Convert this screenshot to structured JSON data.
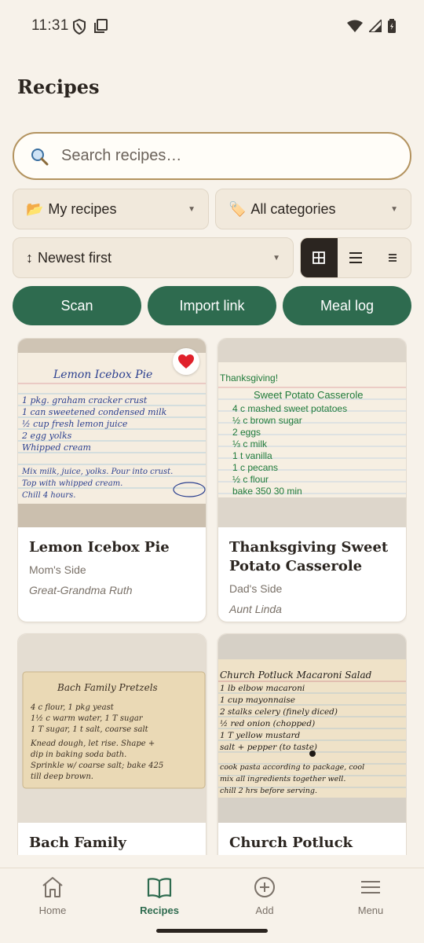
{
  "status": {
    "time": "11:31"
  },
  "title": "Recipes",
  "search": {
    "placeholder": "Search recipes…",
    "value": ""
  },
  "filters": {
    "source": {
      "emoji": "📂",
      "label": "My recipes"
    },
    "category": {
      "emoji": "🏷️",
      "label": "All categories"
    },
    "sort": {
      "emoji": "↕",
      "label": "Newest first"
    }
  },
  "view_modes": [
    "grid-view",
    "list-view",
    "compact-view"
  ],
  "active_view": "grid-view",
  "actions": {
    "scan": "Scan",
    "import": "Import link",
    "meal_log": "Meal log"
  },
  "recipes": [
    {
      "name": "Lemon Icebox Pie",
      "side": "Mom's Side",
      "author": "Great-Grandma Ruth",
      "favorite": true,
      "card_text": [
        "Lemon Icebox Pie",
        "1 pkg. graham cracker crust",
        "1 can sweetened condensed milk",
        "½ cup fresh lemon juice",
        "2 egg yolks",
        "Whipped cream",
        "Mix milk, juice, yolks. Pour into crust.",
        "Top with whipped cream.",
        "Chill 4 hours."
      ]
    },
    {
      "name": "Thanksgiving Sweet Potato Casserole",
      "side": "Dad's Side",
      "author": "Aunt Linda",
      "favorite": false,
      "card_text": [
        "Thanksgiving!",
        "Sweet Potato Casserole",
        "4 c mashed sweet potatoes",
        "½ c brown sugar",
        "2 eggs",
        "⅓ c milk",
        "1 t vanilla",
        "1 c pecans",
        "½ c flour",
        "bake 350  30 min"
      ]
    },
    {
      "name": "Bach Family Pretzels",
      "side": "",
      "author": "",
      "favorite": false,
      "card_text": [
        "Bach Family Pretzels",
        "4 c flour, 1 pkg yeast",
        "1½ c warm water, 1 T sugar",
        "1 T sugar, 1 t salt, coarse salt",
        "Knead dough, let rise. Shape +",
        "dip in baking soda bath.",
        "Sprinkle w/ coarse salt; bake 425",
        "till deep brown."
      ]
    },
    {
      "name": "Church Potluck",
      "side": "",
      "author": "",
      "favorite": false,
      "card_text": [
        "Church Potluck Macaroni Salad",
        "1 lb elbow macaroni",
        "1 cup mayonnaise",
        "2 stalks celery (finely diced)",
        "½ red onion (chopped)",
        "1 T yellow mustard",
        "salt + pepper (to taste)",
        "cook pasta according to package, cool",
        "mix all ingredients together well.",
        "chill 2 hrs before serving."
      ]
    }
  ],
  "nav": {
    "home": "Home",
    "recipes": "Recipes",
    "add": "Add",
    "menu": "Menu",
    "active": "recipes"
  },
  "colors": {
    "accent": "#2e6b4f",
    "background": "#f7f2ea",
    "search_border": "#b3935f",
    "heart": "#e0202a"
  }
}
